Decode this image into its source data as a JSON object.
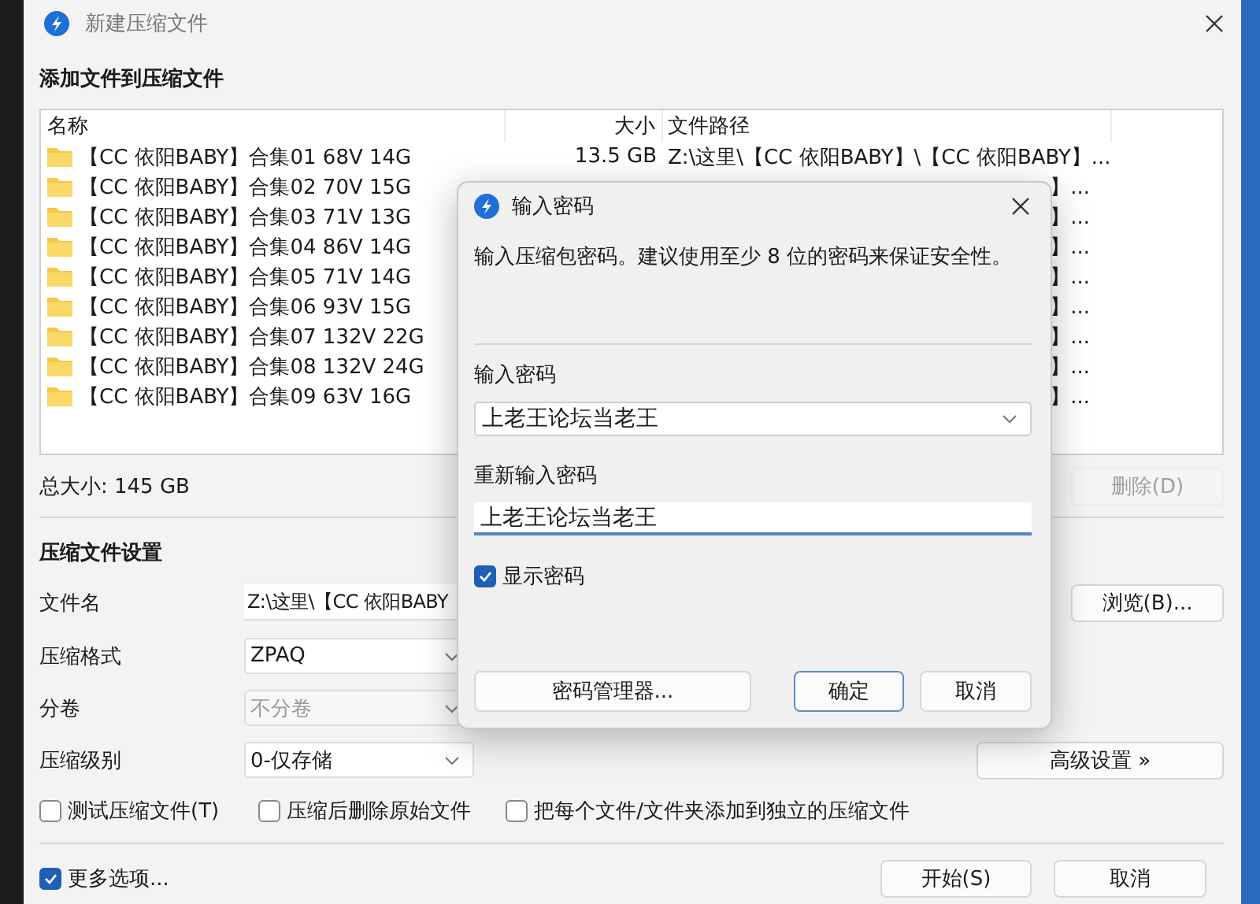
{
  "window": {
    "title": "新建压缩文件"
  },
  "files": {
    "heading": "添加文件到压缩文件",
    "columns": [
      "名称",
      "大小",
      "文件路径"
    ],
    "rows": [
      {
        "name": "【CC 依阳BABY】合集01 68V 14G",
        "size": "13.5 GB",
        "path": "Z:\\这里\\【CC 依阳BABY】\\【CC 依阳BABY】..."
      },
      {
        "name": "【CC 依阳BABY】合集02 70V 15G",
        "path": "】..."
      },
      {
        "name": "【CC 依阳BABY】合集03 71V 13G",
        "path": "】..."
      },
      {
        "name": "【CC 依阳BABY】合集04 86V 14G",
        "path": "】..."
      },
      {
        "name": "【CC 依阳BABY】合集05 71V 14G",
        "path": "】..."
      },
      {
        "name": "【CC 依阳BABY】合集06 93V 15G",
        "path": "】..."
      },
      {
        "name": "【CC 依阳BABY】合集07 132V 22G",
        "path": "】..."
      },
      {
        "name": "【CC 依阳BABY】合集08 132V 24G",
        "path": "】..."
      },
      {
        "name": "【CC 依阳BABY】合集09 63V 16G",
        "path": "】..."
      }
    ],
    "total": "总大小: 145 GB",
    "delete_button": {
      "label": "删除(D)",
      "disabled": true
    }
  },
  "settings": {
    "heading": "压缩文件设置",
    "fields": [
      {
        "kind": "text",
        "label": "文件名",
        "value": "Z:\\这里\\【CC 依阳BABY",
        "disabled": false
      },
      {
        "kind": "dropdown",
        "label": "压缩格式",
        "value": "ZPAQ",
        "disabled": false
      },
      {
        "kind": "dropdown",
        "label": "分卷",
        "value": "不分卷",
        "disabled": true
      },
      {
        "kind": "dropdown",
        "label": "压缩级别",
        "value": "0-仅存储",
        "disabled": false
      }
    ],
    "browse_button": "浏览(B)...",
    "advanced_button": "高级设置 »",
    "options": [
      {
        "label": "测试压缩文件(T)",
        "checked": false
      },
      {
        "label": "压缩后删除原始文件",
        "checked": false
      },
      {
        "label": "把每个文件/文件夹添加到独立的压缩文件",
        "checked": false
      }
    ]
  },
  "footer": {
    "more_options": {
      "label": "更多选项...",
      "checked": true
    },
    "buttons": [
      "开始(S)",
      "取消"
    ]
  },
  "password_dialog": {
    "title": "输入密码",
    "message": "输入压缩包密码。建议使用至少 8 位的密码来保证安全性。",
    "password": {
      "label": "输入密码",
      "value": "上老王论坛当老王",
      "focused": false
    },
    "confirm": {
      "label": "重新输入密码",
      "value": "上老王论坛当老王",
      "focused": true
    },
    "show_password": {
      "label": "显示密码",
      "checked": true
    },
    "buttons": [
      {
        "label": "密码管理器...",
        "default": false
      },
      {
        "label": "确定",
        "default": true
      },
      {
        "label": "取消",
        "default": false
      }
    ]
  }
}
